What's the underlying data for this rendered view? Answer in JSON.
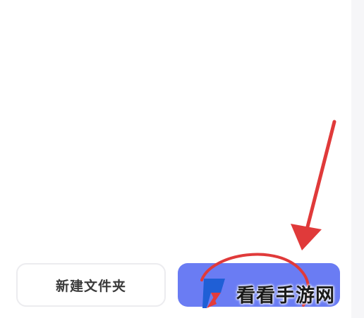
{
  "buttons": {
    "new_folder_label": "新建文件夹",
    "primary_label": ""
  },
  "colors": {
    "primary_button": "#6a7cf3",
    "annotation_red": "#e03a3a",
    "secondary_border": "#ececef"
  },
  "watermark": {
    "text": "看看手游网",
    "logo_icon": "kk-logo-icon"
  },
  "annotation": {
    "arrow_icon": "red-arrow-icon",
    "circle_icon": "red-circle-highlight-icon"
  }
}
